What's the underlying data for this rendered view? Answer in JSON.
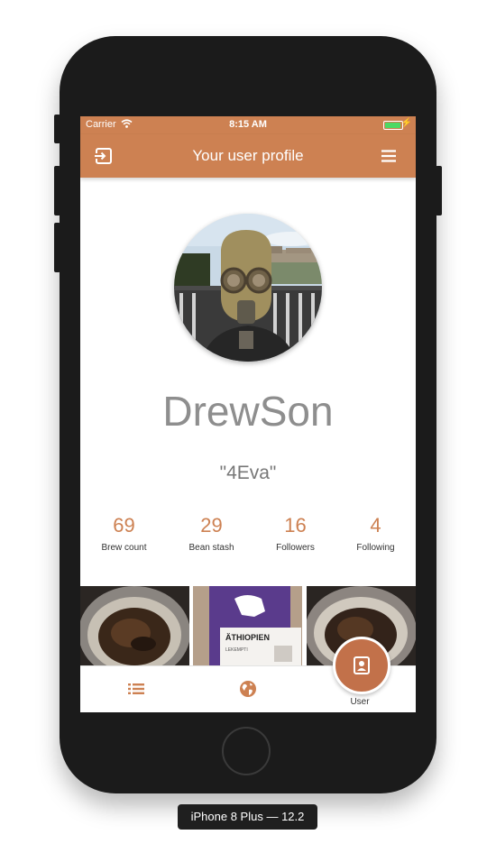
{
  "status_bar": {
    "carrier": "Carrier",
    "time": "8:15 AM"
  },
  "header": {
    "title": "Your user profile",
    "left_icon": "logout-icon",
    "right_icon": "menu-icon"
  },
  "profile": {
    "avatar_icon": "avatar-photo",
    "username": "DrewSon",
    "motto": "\"4Eva\""
  },
  "stats": [
    {
      "value": "69",
      "label": "Brew count"
    },
    {
      "value": "29",
      "label": "Bean stash"
    },
    {
      "value": "16",
      "label": "Followers"
    },
    {
      "value": "4",
      "label": "Following"
    }
  ],
  "photos": [
    {
      "icon": "coffee-grounds-photo"
    },
    {
      "icon": "coffee-bag-photo",
      "bag_title": "ÄTHIOPIEN",
      "bag_sub": "LEKEMPTI"
    },
    {
      "icon": "coffee-grounds-photo"
    }
  ],
  "tab_bar": {
    "items": [
      {
        "icon": "list-icon"
      },
      {
        "icon": "globe-icon"
      },
      {
        "icon": "contact-card-icon",
        "label": "User"
      }
    ]
  },
  "device": {
    "label": "iPhone 8 Plus — 12.2"
  },
  "colors": {
    "accent": "#cd8152",
    "accent_dark": "#c2714a",
    "text_gray": "#8e8e8e",
    "battery": "#4cd964"
  }
}
